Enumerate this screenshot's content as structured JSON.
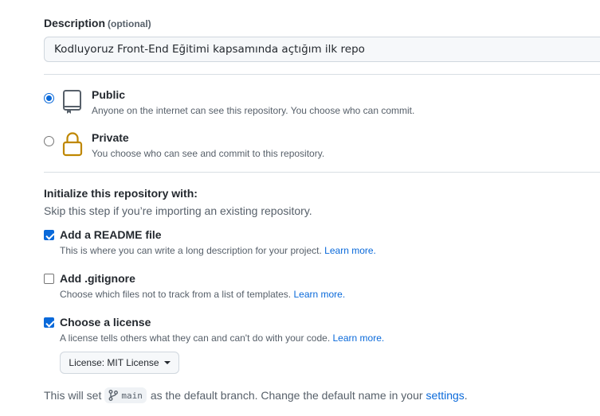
{
  "description": {
    "label": "Description",
    "optional_label": "(optional)",
    "value": "Kodluyoruz Front-End Eğitimi kapsamında açtığım ilk repo"
  },
  "visibility": {
    "options": [
      {
        "title": "Public",
        "desc": "Anyone on the internet can see this repository. You choose who can commit.",
        "selected": true,
        "icon": "repo-icon"
      },
      {
        "title": "Private",
        "desc": "You choose who can see and commit to this repository.",
        "selected": false,
        "icon": "lock-icon"
      }
    ]
  },
  "initialize": {
    "title": "Initialize this repository with:",
    "subtitle": "Skip this step if you’re importing an existing repository.",
    "learn_more": "Learn more.",
    "readme": {
      "label": "Add a README file",
      "desc": "This is where you can write a long description for your project.",
      "checked": true
    },
    "gitignore": {
      "label": "Add .gitignore",
      "desc": "Choose which files not to track from a list of templates.",
      "checked": false
    },
    "license": {
      "label": "Choose a license",
      "desc": "A license tells others what they can and can't do with your code.",
      "checked": true,
      "button_label": "License: MIT License"
    }
  },
  "branch": {
    "prefix": "This will set",
    "name": "main",
    "suffix": "as the default branch. Change the default name in your",
    "link": "settings",
    "end": "."
  },
  "colors": {
    "accent": "#0969da",
    "lock": "#bf8700",
    "text_muted": "#57606a"
  }
}
